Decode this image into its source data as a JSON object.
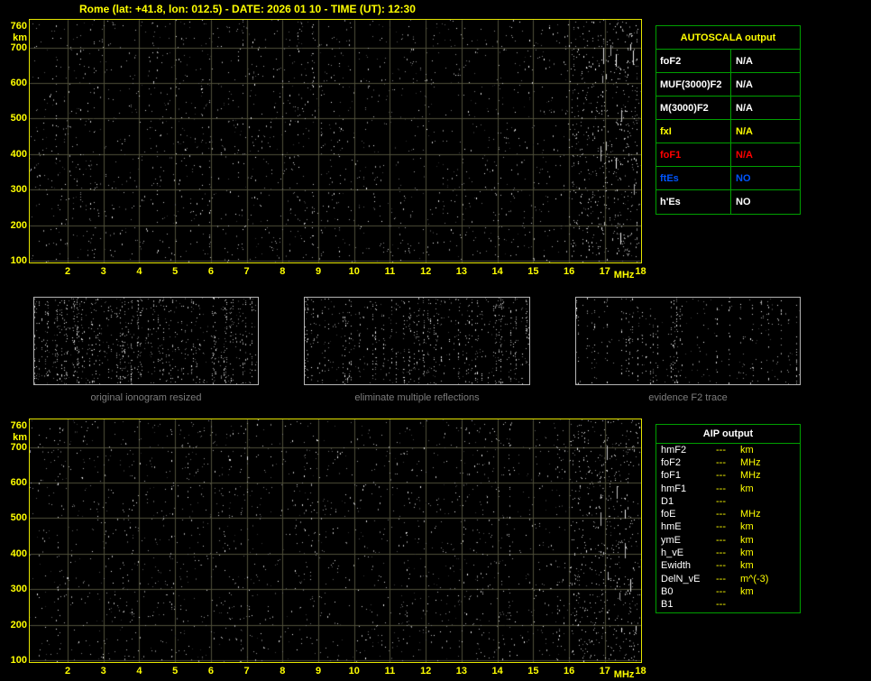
{
  "title": "Rome (lat: +41.8, lon: 012.5) - DATE: 2026 01 10 - TIME (UT): 12:30",
  "colors": {
    "background": "#000000",
    "axis_yellow": "#ffff00",
    "plot_border": "#e6e600",
    "grid": "#4f4f3a",
    "table_green": "#00a000",
    "value_white": "#ffffff",
    "value_yellow": "#ffff00",
    "value_red": "#ff0000",
    "value_blue": "#0055ff",
    "caption_gray": "#7d7d7d",
    "thumb_border": "#b4b4b4"
  },
  "ionogram": {
    "x_ticks": [
      "2",
      "3",
      "4",
      "5",
      "6",
      "7",
      "8",
      "9",
      "10",
      "11",
      "12",
      "13",
      "14",
      "15",
      "16",
      "17",
      "18"
    ],
    "x_unit": "MHz",
    "y_ticks": [
      "760",
      "700",
      "600",
      "500",
      "400",
      "300",
      "200",
      "100"
    ],
    "y_unit": "km"
  },
  "autoscala_table": {
    "title": "AUTOSCALA output",
    "rows": [
      {
        "param": "foF2",
        "value": "N/A",
        "color": "#ffffff"
      },
      {
        "param": "MUF(3000)F2",
        "value": "N/A",
        "color": "#ffffff"
      },
      {
        "param": "M(3000)F2",
        "value": "N/A",
        "color": "#ffffff"
      },
      {
        "param": "fxI",
        "value": "N/A",
        "color": "#ffff00"
      },
      {
        "param": "foF1",
        "value": "N/A",
        "color": "#ff0000"
      },
      {
        "param": "ftEs",
        "value": "NO",
        "color": "#0055ff"
      },
      {
        "param": "h'Es",
        "value": "NO",
        "color": "#ffffff"
      }
    ]
  },
  "thumbnails": [
    {
      "caption": "original ionogram resized"
    },
    {
      "caption": "eliminate multiple reflections"
    },
    {
      "caption": "evidence F2 trace"
    }
  ],
  "aip_table": {
    "title": "AIP output",
    "rows": [
      {
        "param": "hmF2",
        "value": "---",
        "unit": "km"
      },
      {
        "param": "foF2",
        "value": "---",
        "unit": "MHz"
      },
      {
        "param": "foF1",
        "value": "---",
        "unit": "MHz"
      },
      {
        "param": "hmF1",
        "value": "---",
        "unit": "km"
      },
      {
        "param": "D1",
        "value": "---",
        "unit": ""
      },
      {
        "param": "foE",
        "value": "---",
        "unit": "MHz"
      },
      {
        "param": "hmE",
        "value": "---",
        "unit": "km"
      },
      {
        "param": "ymE",
        "value": "---",
        "unit": "km"
      },
      {
        "param": "h_vE",
        "value": "---",
        "unit": "km"
      },
      {
        "param": "Ewidth",
        "value": "---",
        "unit": "km"
      },
      {
        "param": "DelN_vE",
        "value": "---",
        "unit": "m^(-3)"
      },
      {
        "param": "B0",
        "value": "---",
        "unit": "km"
      },
      {
        "param": "B1",
        "value": "---",
        "unit": ""
      }
    ]
  }
}
